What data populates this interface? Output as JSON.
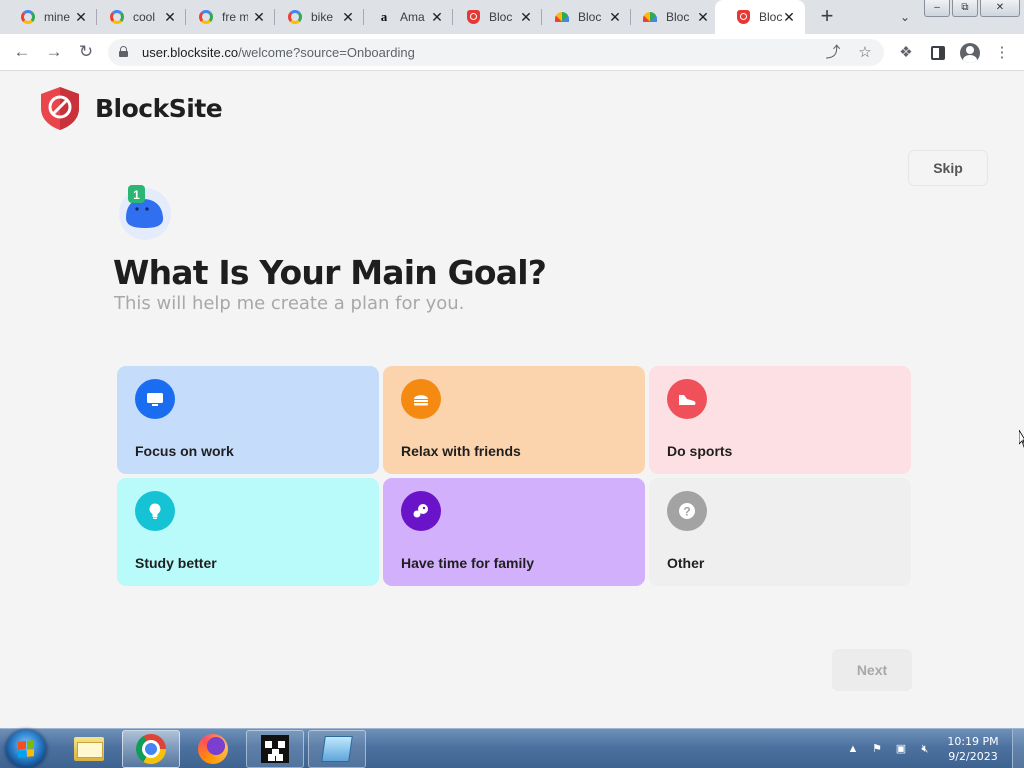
{
  "browser": {
    "tabs": [
      {
        "title": "mine",
        "favicon": "google-icon",
        "active": false
      },
      {
        "title": "cool",
        "favicon": "google-icon",
        "active": false
      },
      {
        "title": "fre m",
        "favicon": "google-icon",
        "active": false
      },
      {
        "title": "bike",
        "favicon": "google-icon",
        "active": false
      },
      {
        "title": "Ama",
        "favicon": "amazon-icon",
        "active": false
      },
      {
        "title": "Bloc",
        "favicon": "blocksite-shield-icon",
        "active": false
      },
      {
        "title": "Bloc",
        "favicon": "rainbow-icon",
        "active": false
      },
      {
        "title": "Bloc",
        "favicon": "rainbow-icon",
        "active": false
      },
      {
        "title": "Bloc",
        "favicon": "blocksite-shield-icon",
        "active": true
      }
    ],
    "new_tab_symbol": "+",
    "url_host": "user.blocksite.co",
    "url_path": "/welcome?source=Onboarding"
  },
  "page": {
    "brand_name": "BlockSite",
    "skip_label": "Skip",
    "step_badge": "1",
    "heading": "What Is Your Main Goal?",
    "subheading": "This will help me create a plan for you.",
    "goals": [
      {
        "label": "Focus on work",
        "bg": "#c6dcfb",
        "icon_bg": "#1a6df0",
        "icon": "monitor-icon"
      },
      {
        "label": "Relax with friends",
        "bg": "#fbd4ad",
        "icon_bg": "#f58a12",
        "icon": "burger-icon"
      },
      {
        "label": "Do sports",
        "bg": "#fde0e4",
        "icon_bg": "#f0505a",
        "icon": "sneaker-icon"
      },
      {
        "label": "Study better",
        "bg": "#b9fbfa",
        "icon_bg": "#15c3d4",
        "icon": "lightbulb-icon"
      },
      {
        "label": "Have time for family",
        "bg": "#d2b0fb",
        "icon_bg": "#6a14c9",
        "icon": "family-icon"
      },
      {
        "label": "Other",
        "bg": "#efefef",
        "icon_bg": "#a3a3a3",
        "icon": "question-icon"
      }
    ],
    "next_label": "Next"
  },
  "taskbar": {
    "apps": [
      "file-explorer-icon",
      "chrome-icon",
      "firefox-icon",
      "minecraft-icon",
      "notes-icon"
    ],
    "time": "10:19 PM",
    "date": "9/2/2023"
  }
}
